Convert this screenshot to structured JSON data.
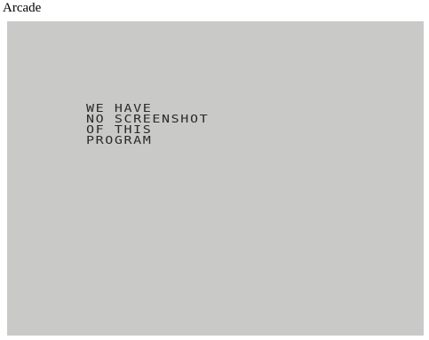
{
  "header": {
    "title": "Arcade"
  },
  "screen": {
    "background": "#c9c9c8",
    "text_color": "#2a2a2a",
    "lines": [
      "WE HAVE",
      "NO SCREENSHOT",
      "OF THIS",
      "PROGRAM"
    ]
  }
}
